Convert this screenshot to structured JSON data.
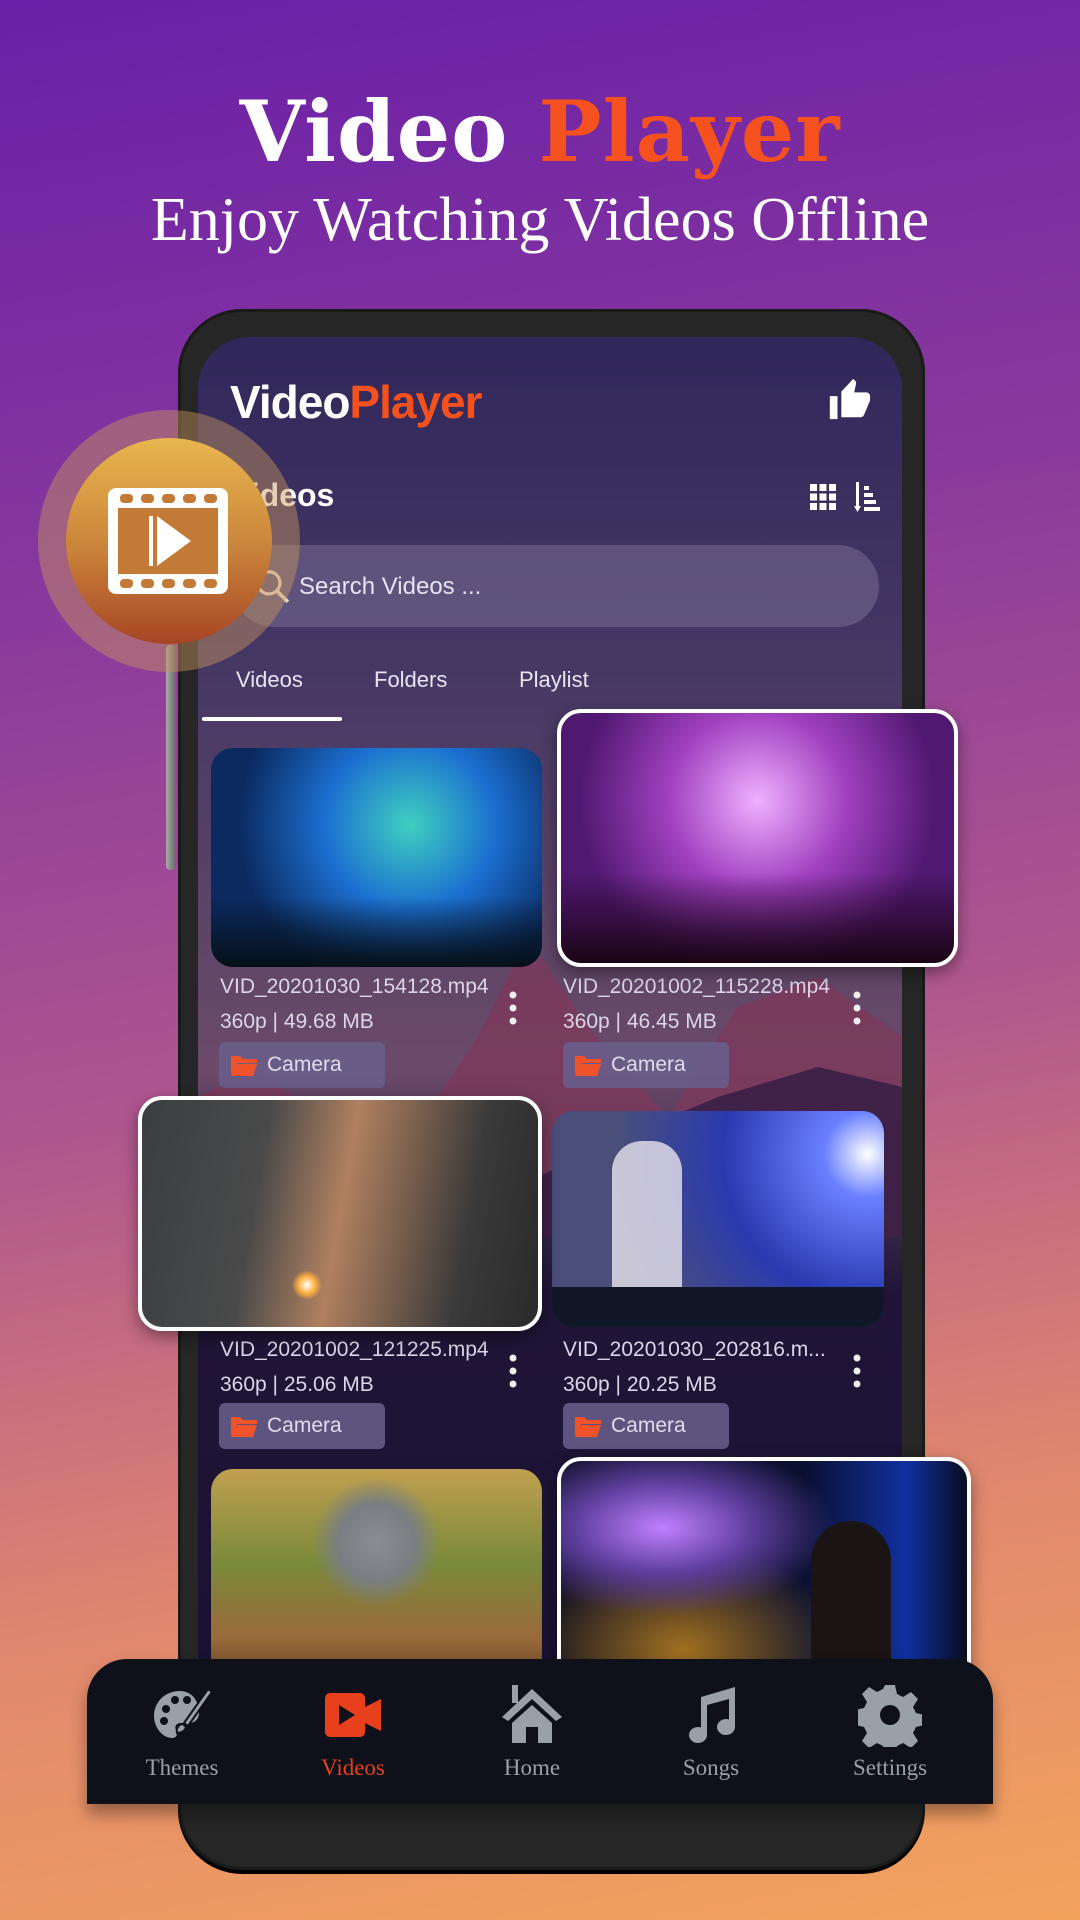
{
  "hero": {
    "title_part1": "Video",
    "title_part2": "Player",
    "subtitle": "Enjoy Watching Videos Offline"
  },
  "app": {
    "logo_part1": "Video",
    "logo_part2": "Player",
    "section_title": "Videos",
    "section_title_visible": "deos",
    "accent_color": "#f4511e"
  },
  "search": {
    "placeholder": "Search Videos ..."
  },
  "tabs": [
    {
      "label": "Videos",
      "active": true
    },
    {
      "label": "Folders",
      "active": false
    },
    {
      "label": "Playlist",
      "active": false
    }
  ],
  "videos": [
    {
      "title": "VID_20201030_154128.mp4",
      "meta": "360p | 49.68 MB",
      "folder": "Camera",
      "thumb": "concert-lights"
    },
    {
      "title": "VID_20201002_115228.mp4",
      "meta": "360p | 46.45 MB",
      "folder": "Camera",
      "thumb": "concert-fireworks"
    },
    {
      "title": "VID_20201002_121225.mp4",
      "meta": "360p | 25.06 MB",
      "folder": "Camera",
      "thumb": "guitarist"
    },
    {
      "title": "VID_20201030_202816.m...",
      "meta": "360p | 20.25 MB",
      "folder": "Camera",
      "thumb": "dj"
    },
    {
      "title": "",
      "meta": "",
      "folder": "",
      "thumb": "child-outdoors"
    },
    {
      "title": "",
      "meta": "",
      "folder": "",
      "thumb": "singer"
    }
  ],
  "bottom_nav": [
    {
      "label": "Themes",
      "icon": "palette-icon",
      "active": false
    },
    {
      "label": "Videos",
      "icon": "video-camera-icon",
      "active": true
    },
    {
      "label": "Home",
      "icon": "home-icon",
      "active": false
    },
    {
      "label": "Songs",
      "icon": "music-note-icon",
      "active": false
    },
    {
      "label": "Settings",
      "icon": "gear-icon",
      "active": false
    }
  ]
}
